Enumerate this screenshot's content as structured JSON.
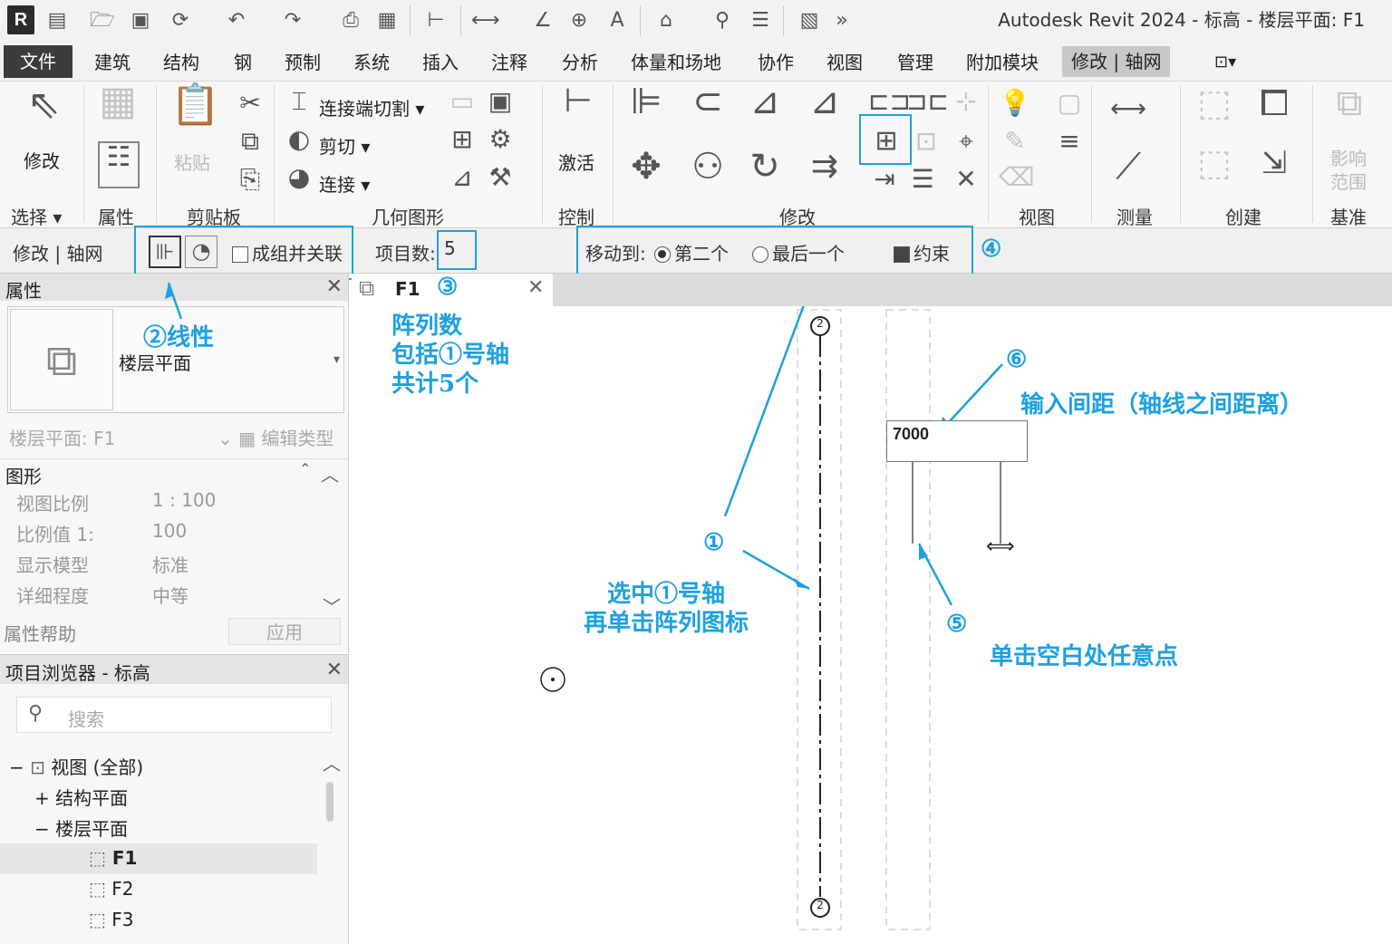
{
  "window": {
    "title": "Autodesk Revit 2024 - 标高 - 楼层平面: F1",
    "logo": "R"
  },
  "qat_icons": [
    "open-icon",
    "save-icon",
    "sync-icon",
    "undo-icon",
    "redo-icon",
    "print-icon",
    "measure-icon",
    "dimension-icon",
    "spot-icon",
    "text-icon",
    "home-icon",
    "close-hidden-icon"
  ],
  "menu": [
    "文件",
    "建筑",
    "结构",
    "钢",
    "预制",
    "系统",
    "插入",
    "注释",
    "分析",
    "体量和场地",
    "协作",
    "视图",
    "管理",
    "附加模块",
    "修改 | 轴网"
  ],
  "ribbon": {
    "modify": "修改",
    "select": "选择",
    "properties": "属性",
    "clipboard": "剪贴板",
    "paste": "粘贴",
    "geometry": "几何图形",
    "cut_join": "连接端切割",
    "cut": "剪切",
    "join": "连接",
    "control": "控制",
    "activate": "激活",
    "modify_panel": "修改",
    "view": "视图",
    "measure": "测量",
    "create": "创建",
    "datum": "基准",
    "scope": "影响范围"
  },
  "optbar": {
    "context": "修改 | 轴网",
    "group_assoc": "成组并关联",
    "item_count_label": "项目数:",
    "item_count": "5",
    "move_to": "移动到:",
    "second": "第二个",
    "last": "最后一个",
    "constrain": "约束"
  },
  "properties": {
    "title": "属性",
    "type_name": "楼层平面",
    "instance": "楼层平面: F1",
    "edit_type": "编辑类型",
    "group": "图形",
    "rows": [
      {
        "k": "视图比例",
        "v": "1 : 100"
      },
      {
        "k": "比例值 1:",
        "v": "100"
      },
      {
        "k": "显示模型",
        "v": "标准"
      },
      {
        "k": "详细程度",
        "v": "中等"
      }
    ],
    "help": "属性帮助",
    "apply": "应用"
  },
  "browser": {
    "title": "项目浏览器 - 标高",
    "search_placeholder": "搜索",
    "views": "视图 (全部)",
    "struct_plans": "结构平面",
    "floor_plans": "楼层平面",
    "levels": [
      "F1",
      "F2",
      "F3"
    ]
  },
  "tab": {
    "label": "F1"
  },
  "canvas": {
    "grid_bubble": "2",
    "spacing_value": "7000"
  },
  "annotations": {
    "n1": "①",
    "n2_linear": "②线性",
    "n3": "③",
    "n3_text": [
      "阵列数",
      "包括①号轴",
      "共计5个"
    ],
    "n4": "④",
    "n5": "⑤",
    "n5_text": "单击空白处任意点",
    "n6": "⑥",
    "n6_text": "输入间距（轴线之间距离）",
    "n1_text": [
      "选中①号轴",
      "再单击阵列图标"
    ]
  },
  "colors": {
    "annotation": "#1ea0e0",
    "file_menu": "#3c3c3c"
  }
}
